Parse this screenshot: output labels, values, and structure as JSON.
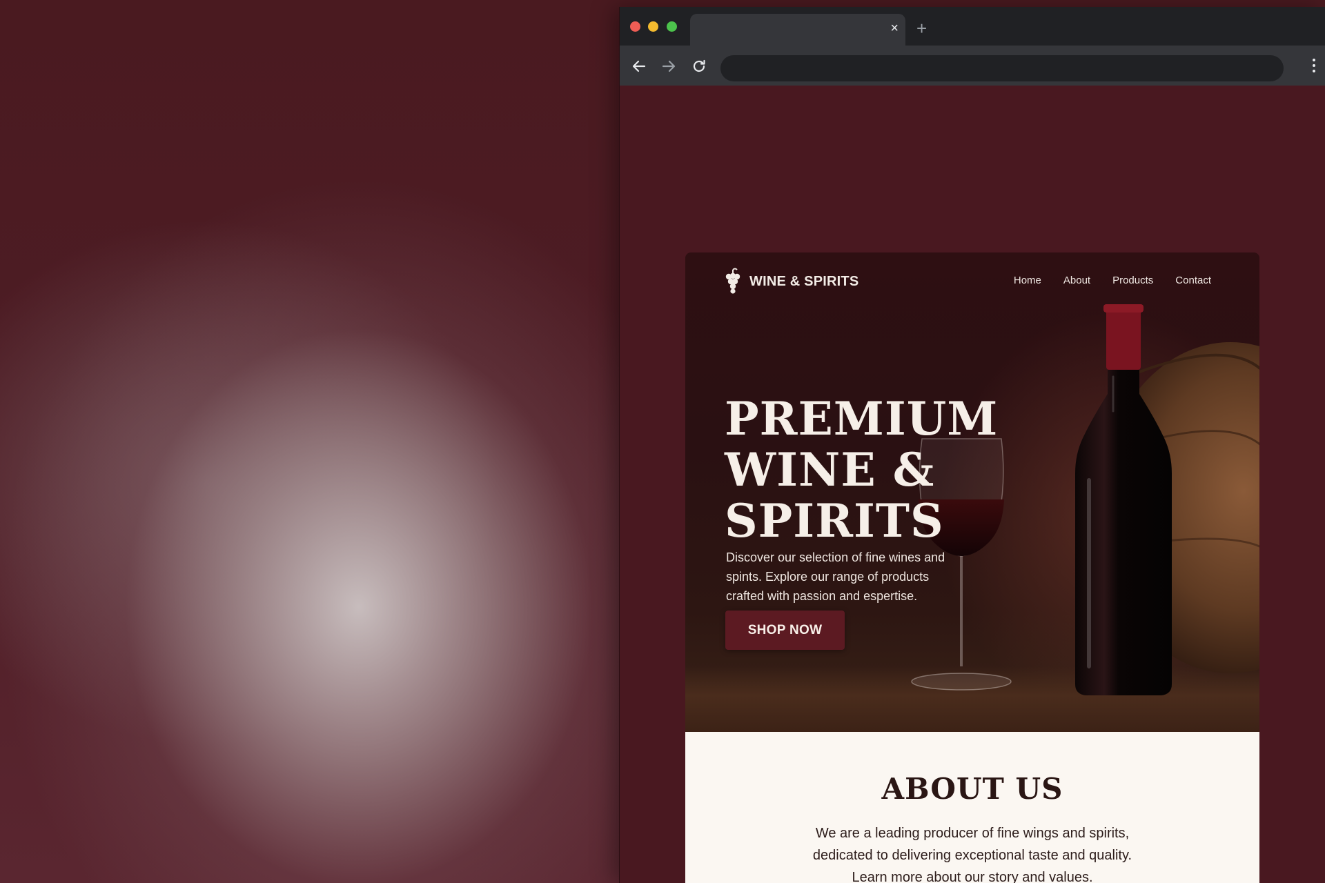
{
  "brand": {
    "name": "WINE & SPIRITS",
    "accent_color": "#5c1a22",
    "logo_icon": "grape-icon"
  },
  "browser": {
    "tab_close_glyph": "×",
    "new_tab_glyph": "+"
  },
  "nav": {
    "items": [
      {
        "label": "Home"
      },
      {
        "label": "About"
      },
      {
        "label": "Products"
      },
      {
        "label": "Contact"
      }
    ]
  },
  "hero": {
    "title_line1": "PREMIUM",
    "title_line2": "WINE &",
    "title_line3": "SPIRITS",
    "description": "Discover our selection of fine wines and spints. Explore our range of products crafted with passion and espertise.",
    "cta_label": "SHOP NOW"
  },
  "about": {
    "title": "ABOUT US",
    "text": "We are a leading producer of fine wings and spirits, dedicated to delivering exceptional taste and quality. Learn more about our story and values."
  }
}
